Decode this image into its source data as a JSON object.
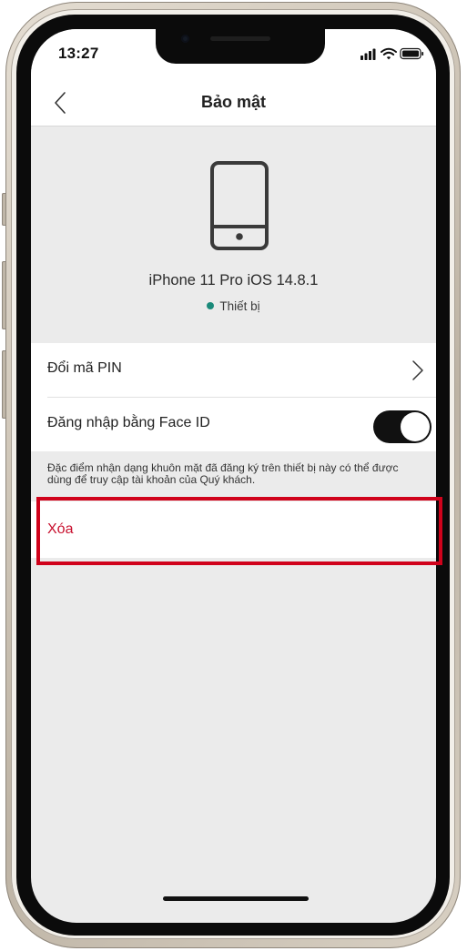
{
  "status_bar": {
    "time": "13:27",
    "icons": [
      "signal-icon",
      "wifi-icon",
      "battery-icon"
    ]
  },
  "nav": {
    "title": "Bảo mật",
    "back_icon": "chevron-left-icon"
  },
  "device": {
    "icon": "smartphone-icon",
    "name": "iPhone 11 Pro iOS 14.8.1",
    "status_label": "Thiết bị",
    "status_color": "#1b8a7a"
  },
  "settings": {
    "change_pin_label": "Đổi mã PIN",
    "face_id_label": "Đăng nhập bằng Face ID",
    "face_id_enabled": true
  },
  "footnote": "Đặc điểm nhận dạng khuôn mặt đã đăng ký trên thiết bị này có thể được dùng để truy cập tài khoản của Quý khách.",
  "delete": {
    "label": "Xóa",
    "color": "#c8102e"
  },
  "highlight": {
    "color": "#d0021b",
    "target": "delete-row"
  }
}
